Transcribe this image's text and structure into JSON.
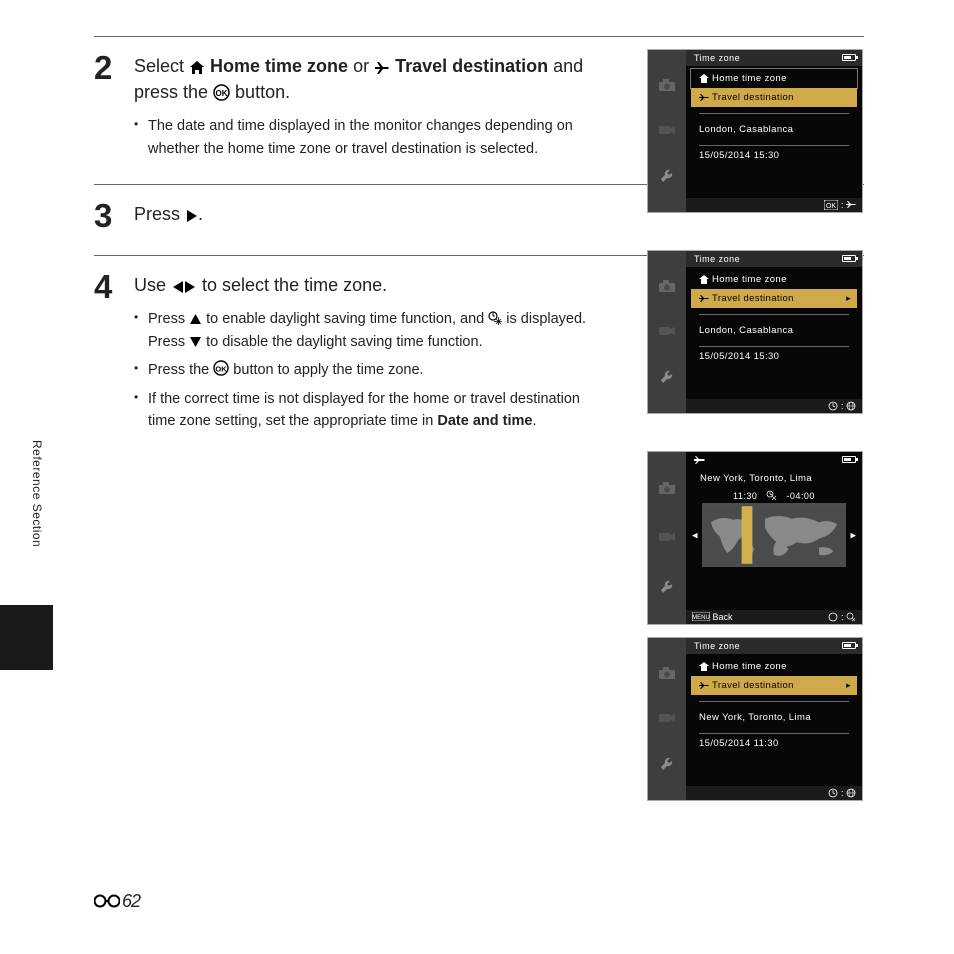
{
  "side_label": "Reference Section",
  "page_number": "62",
  "steps": [
    {
      "num": "2",
      "head_parts": {
        "a": "Select ",
        "b": " Home time zone",
        "c": " or ",
        "d": " Travel destination",
        "e": " and press the ",
        "f": " button."
      },
      "bullets": [
        "The date and time displayed in the monitor changes depending on whether the home time zone or travel destination is selected."
      ]
    },
    {
      "num": "3",
      "head_parts": {
        "a": "Press ",
        "b": "."
      }
    },
    {
      "num": "4",
      "head_parts": {
        "a": "Use ",
        "b": " to select the time zone."
      },
      "bullets": [
        {
          "pre": "Press ",
          "mid": " to enable daylight saving time function, and ",
          "post": " is displayed. Press ",
          "end": " to disable the daylight saving time function."
        },
        {
          "pre": "Press the ",
          "post": " button to apply the time zone."
        },
        {
          "pre": "If the correct time is not displayed for the home or travel destination time zone setting, set the appropriate time in ",
          "bold": "Date and time",
          "post2": "."
        }
      ]
    }
  ],
  "shots": [
    {
      "id": "s1",
      "title": "Time zone",
      "home": "Home time zone",
      "travel": "Travel destination",
      "loc": "London, Casablanca",
      "dt": "15/05/2014  15:30",
      "selected": "travel",
      "chev": false,
      "foot_right_ok": true
    },
    {
      "id": "s2",
      "title": "Time zone",
      "home": "Home time zone",
      "travel": "Travel destination",
      "loc": "London, Casablanca",
      "dt": "15/05/2014  15:30",
      "selected": "travel",
      "chev": true,
      "foot_right_globe": true
    },
    {
      "id": "s3map",
      "map_city": "New York, Toronto, Lima",
      "map_time": "11:30",
      "map_offset": "-04:00",
      "back": "Back"
    },
    {
      "id": "s4",
      "title": "Time zone",
      "home": "Home time zone",
      "travel": "Travel destination",
      "loc": "New York, Toronto, Lima",
      "dt": "15/05/2014  11:30",
      "selected": "travel",
      "chev": true,
      "foot_right_globe": true
    }
  ]
}
